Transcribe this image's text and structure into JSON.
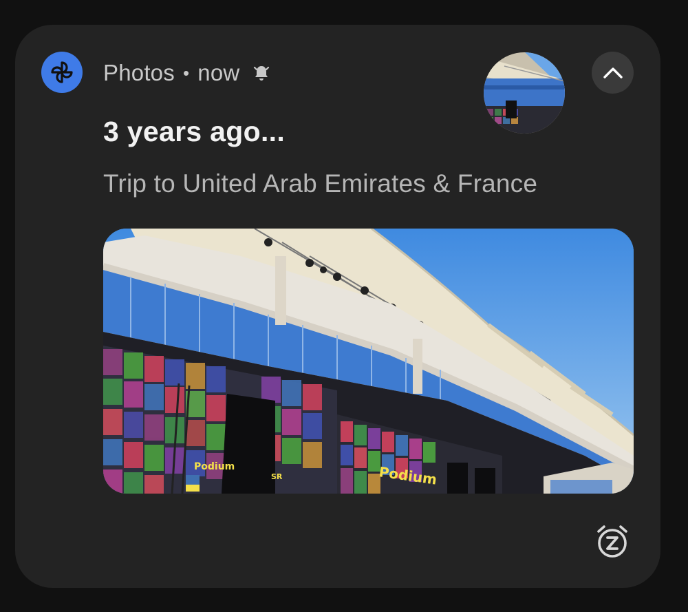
{
  "notification": {
    "app_name": "Photos",
    "separator": "•",
    "time": "now",
    "title": "3 years ago...",
    "subtitle": "Trip to United Arab Emirates & France",
    "icons": {
      "app": "pinwheel-icon",
      "alert": "bell-icon",
      "collapse": "chevron-up-icon",
      "snooze": "snooze-icon"
    },
    "photo_labels": {
      "podium_left": "Podium",
      "podium_right": "Podium",
      "sr": "SR"
    },
    "colors": {
      "card": "#232323",
      "background": "#111111",
      "accent": "#3f7be8",
      "sky": "#5a9ee6"
    }
  }
}
